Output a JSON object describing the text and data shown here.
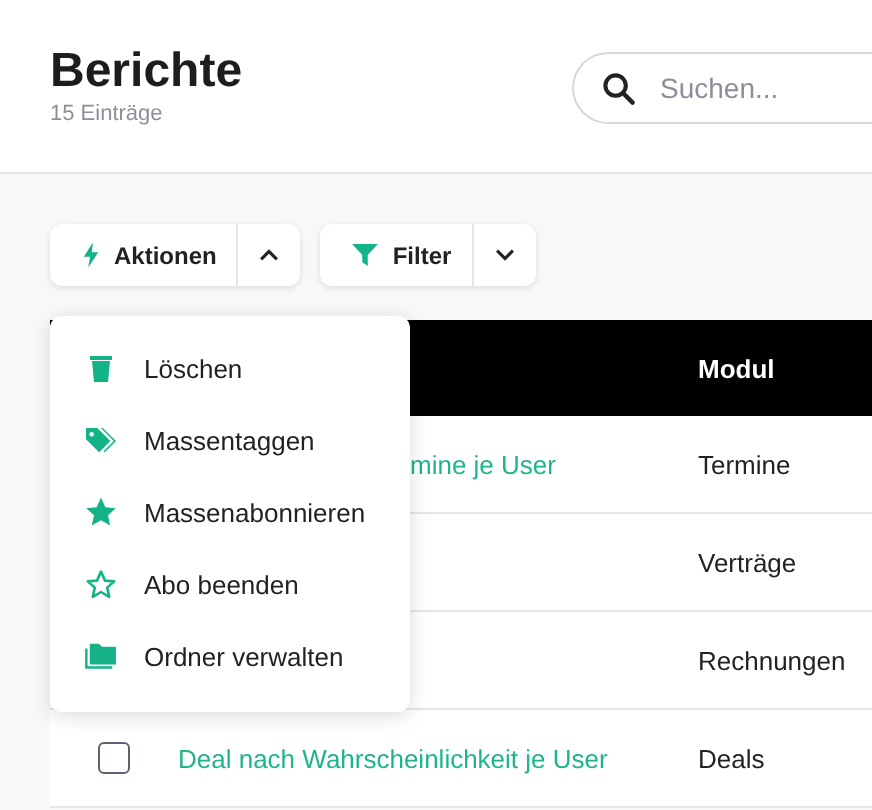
{
  "header": {
    "title": "Berichte",
    "subtitle": "15 Einträge"
  },
  "search": {
    "placeholder": "Suchen..."
  },
  "toolbar": {
    "actions": {
      "label": "Aktionen",
      "expanded": true
    },
    "filter": {
      "label": "Filter",
      "expanded": false
    }
  },
  "table": {
    "columns": [
      "Modul"
    ],
    "rows": [
      {
        "title": "mine je User",
        "cut_by_menu": true,
        "module": "Termine"
      },
      {
        "module": "Verträge"
      },
      {
        "module": "Rechnungen"
      },
      {
        "title": "Deal nach Wahrscheinlichkeit je User",
        "cut_by_menu": false,
        "checked": false,
        "module": "Deals"
      }
    ]
  },
  "actions_menu": {
    "items": [
      {
        "kind": "trash",
        "label": "Löschen"
      },
      {
        "kind": "tag",
        "label": "Massentaggen"
      },
      {
        "kind": "star",
        "label": "Massenabonnieren"
      },
      {
        "kind": "star-outline",
        "label": "Abo beenden"
      },
      {
        "kind": "folder",
        "label": "Ordner verwalten"
      }
    ]
  }
}
